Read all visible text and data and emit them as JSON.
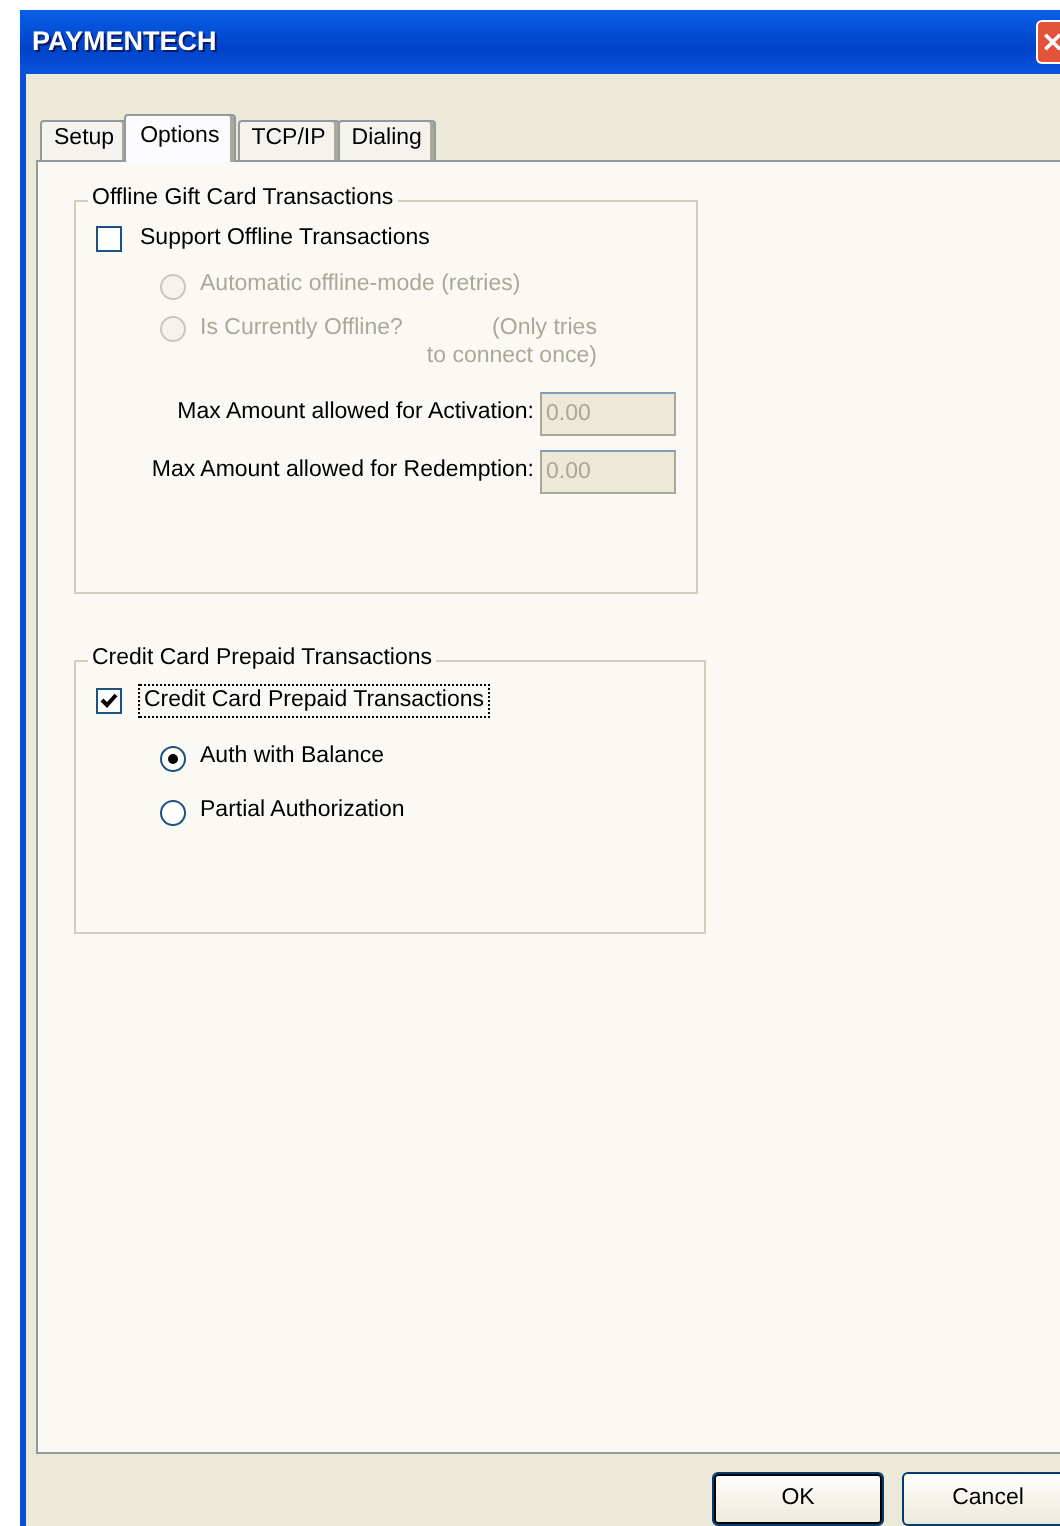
{
  "window": {
    "title": "PAYMENTECH"
  },
  "tabs": [
    {
      "label": "Setup",
      "selected": false
    },
    {
      "label": "Options",
      "selected": true
    },
    {
      "label": "TCP/IP",
      "selected": false
    },
    {
      "label": "Dialing",
      "selected": false
    }
  ],
  "offline_group": {
    "title": "Offline Gift Card Transactions",
    "checkbox": {
      "label": "Support Offline Transactions",
      "checked": false
    },
    "radios": [
      {
        "label": "Automatic offline-mode (retries)",
        "selected": false,
        "disabled": true
      },
      {
        "label": "Is Currently Offline?",
        "note_lines": [
          "(Only tries",
          "to connect once)"
        ],
        "selected": false,
        "disabled": true
      }
    ],
    "fields": [
      {
        "label": "Max Amount allowed for Activation:",
        "value": "0.00",
        "disabled": true
      },
      {
        "label": "Max Amount allowed for Redemption:",
        "value": "0.00",
        "disabled": true
      }
    ]
  },
  "prepaid_group": {
    "title": "Credit Card Prepaid Transactions",
    "checkbox": {
      "label": "Credit Card Prepaid Transactions",
      "checked": true
    },
    "radios": [
      {
        "label": "Auth with Balance",
        "selected": true,
        "disabled": false
      },
      {
        "label": "Partial Authorization",
        "selected": false,
        "disabled": false
      }
    ]
  },
  "buttons": [
    {
      "label": "OK",
      "default": true
    },
    {
      "label": "Cancel",
      "default": false
    }
  ]
}
